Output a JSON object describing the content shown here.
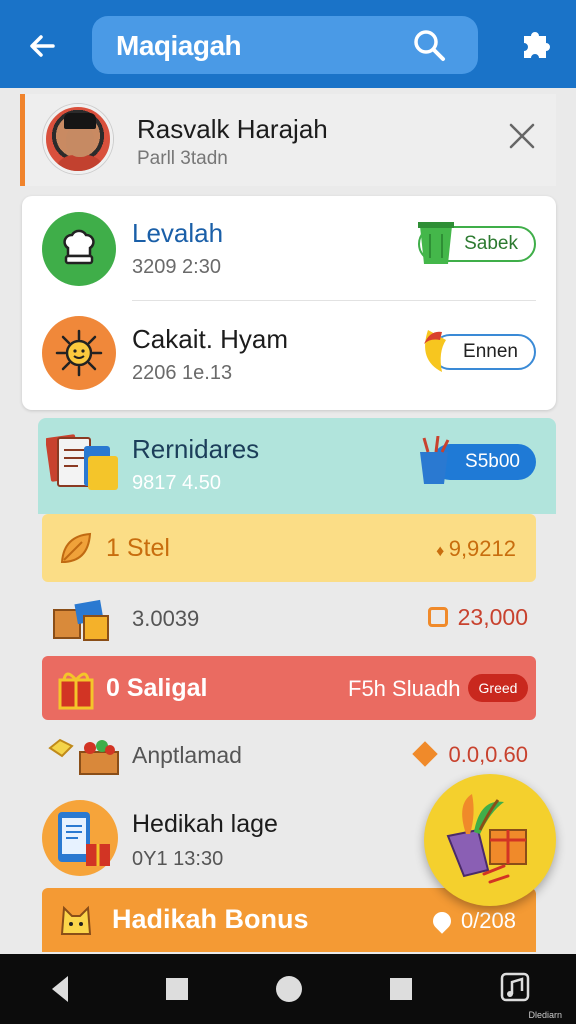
{
  "topbar": {
    "search_text": "Maqiagah",
    "back_icon": "arrow-left-icon",
    "search_icon": "search-icon",
    "puzzle_icon": "puzzle-icon",
    "color": "#1a73c8"
  },
  "profile": {
    "name": "Rasvalk Harajah",
    "subtitle": "Parll 3tadn",
    "accent": "#f0832c"
  },
  "card_rows": [
    {
      "title": "Levalah",
      "subtitle": "3209 2:30",
      "pill": "Sabek",
      "icon": "chef-hat-icon",
      "icon_color": "#3fae49"
    },
    {
      "title": "Cakait. Hyam",
      "subtitle": "2206 1e.13",
      "pill": "Ennen",
      "icon": "sun-icon",
      "icon_color": "#f0883a"
    }
  ],
  "teal_row": {
    "title": "Rernidares",
    "subtitle": "9817 4.50",
    "pill": "S5b00"
  },
  "yellow_row": {
    "title": "1 Stel",
    "value": "9,9212"
  },
  "plain_row_1": {
    "title": "3.0039",
    "value": "23,000"
  },
  "red_row": {
    "title": "0 Saligal",
    "right_text": "F5h Sluadh",
    "badge": "Greed"
  },
  "plain_row_2": {
    "title": "Anptlamad",
    "value": "0.0,0.60"
  },
  "promo_row": {
    "title": "Hedikah lage",
    "subtitle": "0Y1 13:30"
  },
  "orange_row": {
    "title": "Hadikah Bonus",
    "value": "0/208"
  },
  "navbar": {
    "label": "Dlediarn"
  }
}
